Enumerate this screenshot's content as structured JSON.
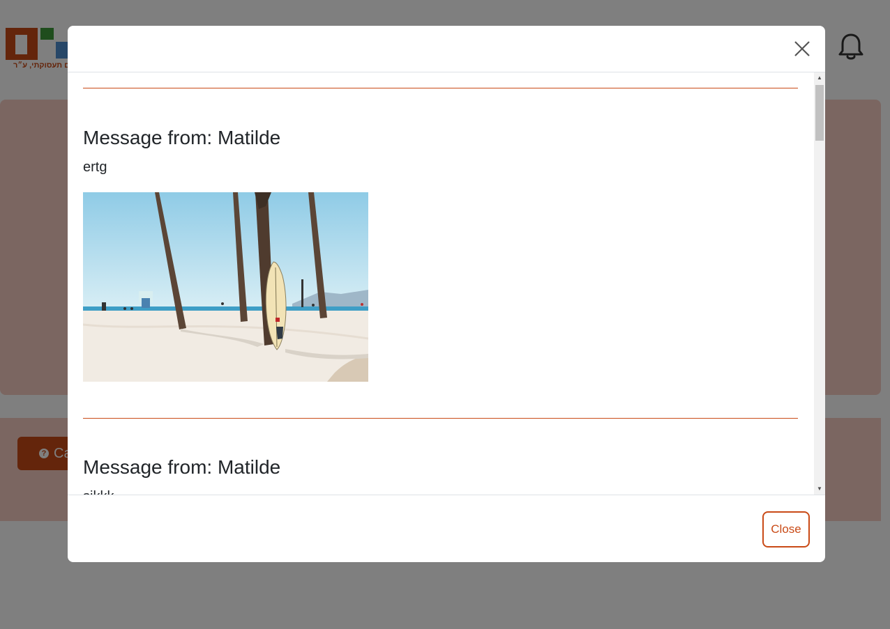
{
  "background": {
    "logo": {
      "tagline": "ם תעסוקתי, ע״ר"
    },
    "cta_button": {
      "label": "Ca"
    }
  },
  "modal": {
    "close_icon": "close-icon",
    "messages": [
      {
        "title": "Message from: Matilde",
        "text": "ertg",
        "image": "beach-palms-surfboard-photo"
      },
      {
        "title": "Message from: Matilde",
        "text": "sjkkk"
      }
    ],
    "footer": {
      "close_label": "Close"
    }
  },
  "colors": {
    "accent": "#c94a16",
    "panel": "#f6cdc3",
    "text": "#212529"
  }
}
